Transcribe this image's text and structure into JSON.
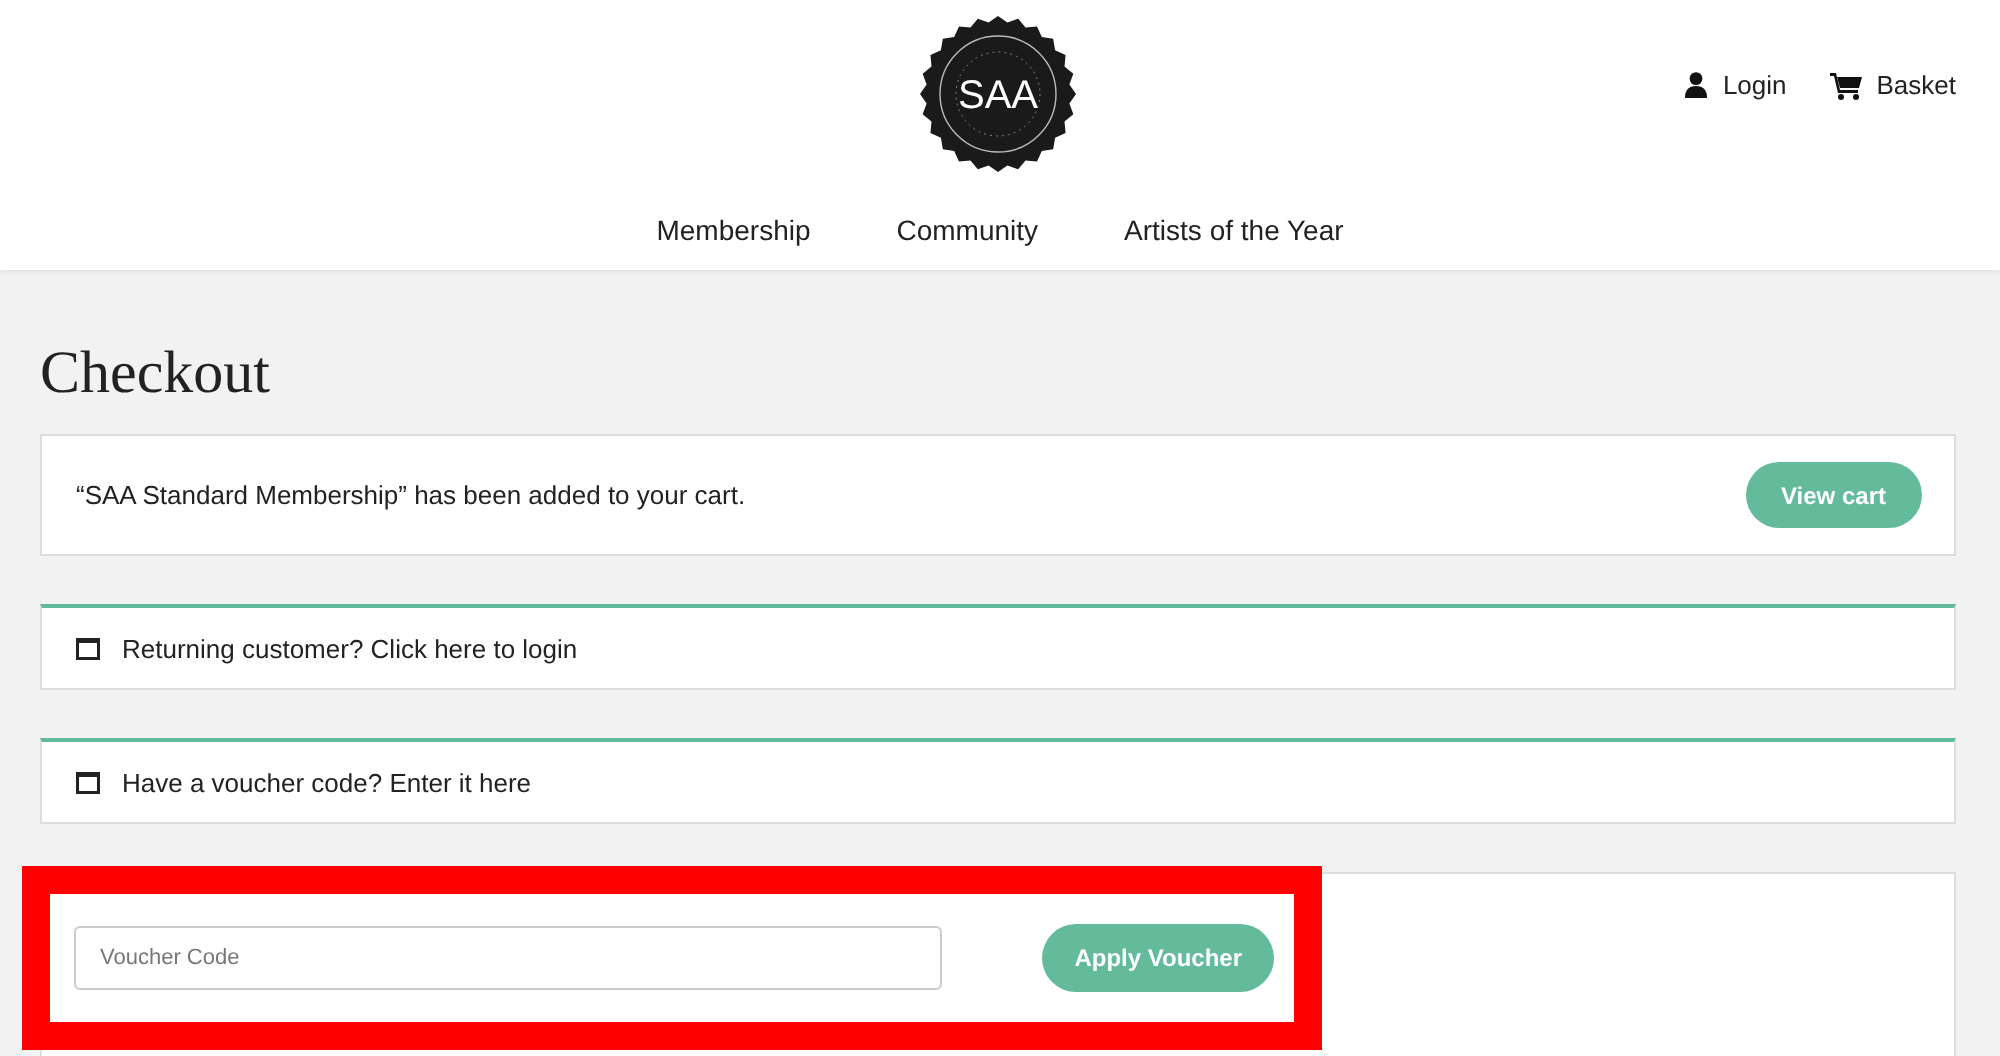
{
  "header": {
    "logo": "SAA",
    "actions": [
      {
        "kind": "user",
        "label": "Login"
      },
      {
        "kind": "cart",
        "label": "Basket"
      }
    ],
    "nav": [
      "Membership",
      "Community",
      "Artists of the Year"
    ]
  },
  "page_title": "Checkout",
  "notice": {
    "message": "“SAA Standard Membership” has been added to your cart.",
    "button": "View cart"
  },
  "info_boxes": [
    {
      "text": "Returning customer?",
      "link": "Click here to login"
    },
    {
      "text": "Have a voucher code?",
      "link": "Enter it here"
    }
  ],
  "voucher_form": {
    "placeholder": "Voucher Code",
    "button": "Apply Voucher",
    "highlighted": true
  }
}
